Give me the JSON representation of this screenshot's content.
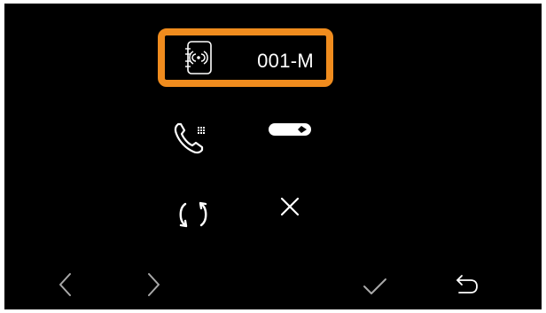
{
  "device": {
    "label": "001-M",
    "icon": "door-intercom-device-icon",
    "highlight_color": "#f08c1e"
  },
  "controls": [
    {
      "name": "intercom-call-icon"
    },
    {
      "name": "toggle-switch-icon"
    },
    {
      "name": "refresh-icon"
    },
    {
      "name": "close-icon"
    }
  ],
  "nav": {
    "prev_icon": "chevron-left-icon",
    "next_icon": "chevron-right-icon",
    "confirm_icon": "checkmark-icon",
    "back_icon": "return-arrow-icon"
  },
  "colors": {
    "background": "#000000",
    "foreground": "#ffffff",
    "nav_muted": "#a9a9a9",
    "accent": "#f08c1e"
  }
}
